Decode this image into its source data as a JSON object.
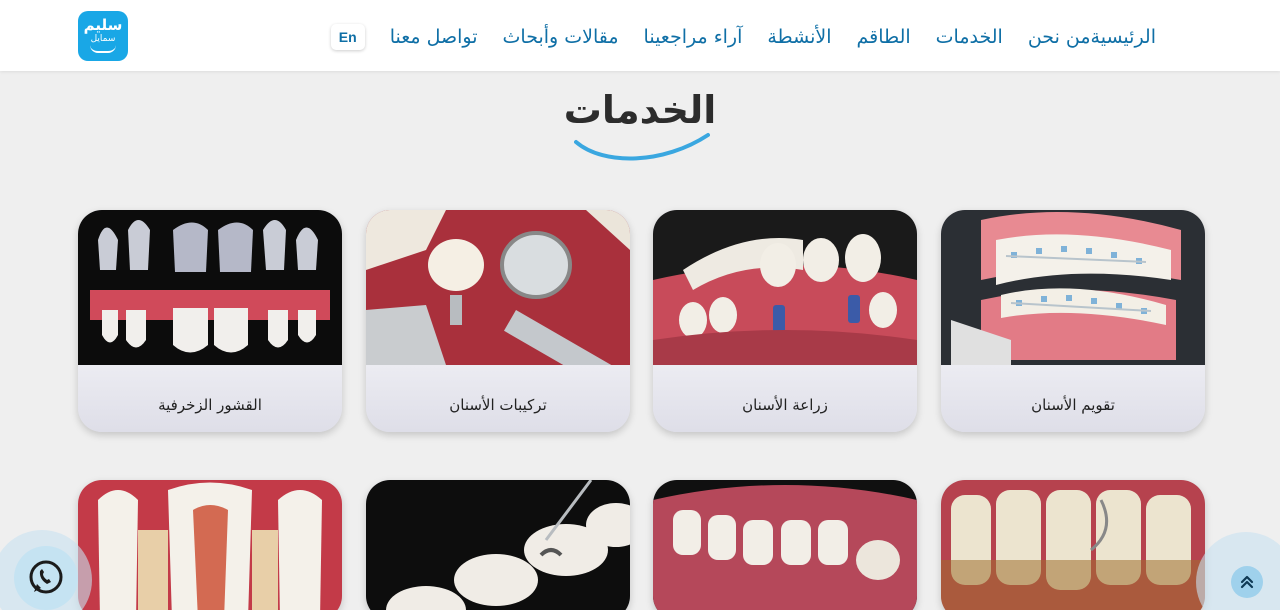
{
  "logo": {
    "line1": "سليم",
    "line2": "سمايل"
  },
  "nav": {
    "items": [
      "الرئيسية",
      "من نحن",
      "الخدمات",
      "الطاقم",
      "الأنشطة",
      "آراء مراجعينا",
      "مقالات وأبحاث",
      "تواصل معنا"
    ],
    "lang_label": "En"
  },
  "section": {
    "title": "الخدمات"
  },
  "services": [
    {
      "label": "تقويم الأسنان",
      "icon": "braces-image"
    },
    {
      "label": "زراعة الأسنان",
      "icon": "implants-image"
    },
    {
      "label": "تركيبات الأسنان",
      "icon": "crown-image"
    },
    {
      "label": "القشور الزخرفية",
      "icon": "veneers-image"
    }
  ],
  "colors": {
    "nav_text": "#0f6fa6",
    "logo_bg": "#19a7e6",
    "swoosh": "#3aa7e0",
    "page_bg": "#efefef"
  },
  "floating": {
    "whatsapp_icon": "whatsapp-icon",
    "scroll_top_icon": "double-chevron-up-icon"
  }
}
